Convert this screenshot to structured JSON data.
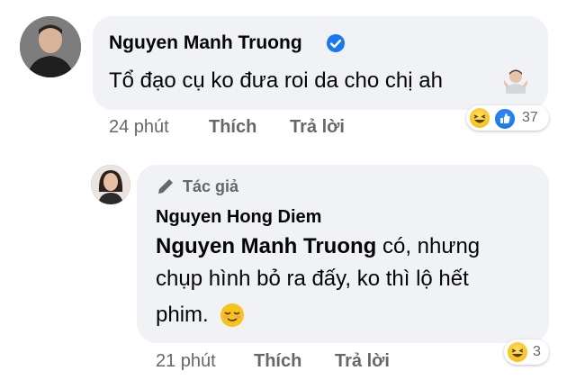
{
  "comment": {
    "author": "Nguyen Manh Truong",
    "text": "Tổ đạo cụ ko đưa roi da cho chị ah",
    "time": "24 phút",
    "like_label": "Thích",
    "reply_label": "Trả lời",
    "reaction_count": "37"
  },
  "reply": {
    "author_badge": "Tác giả",
    "author": "Nguyen Hong Diem",
    "mention": "Nguyen Manh Truong",
    "text_line1": " có, nhưng",
    "text_line2": "chụp hình bỏ ra đấy, ko thì lộ hết",
    "text_line3": "phim.",
    "time": "21 phút",
    "like_label": "Thích",
    "reply_label": "Trả lời",
    "reaction_count": "3"
  },
  "colors": {
    "bubble": "#f0f2f5",
    "meta_text": "#65676b",
    "verified": "#1877f2"
  }
}
